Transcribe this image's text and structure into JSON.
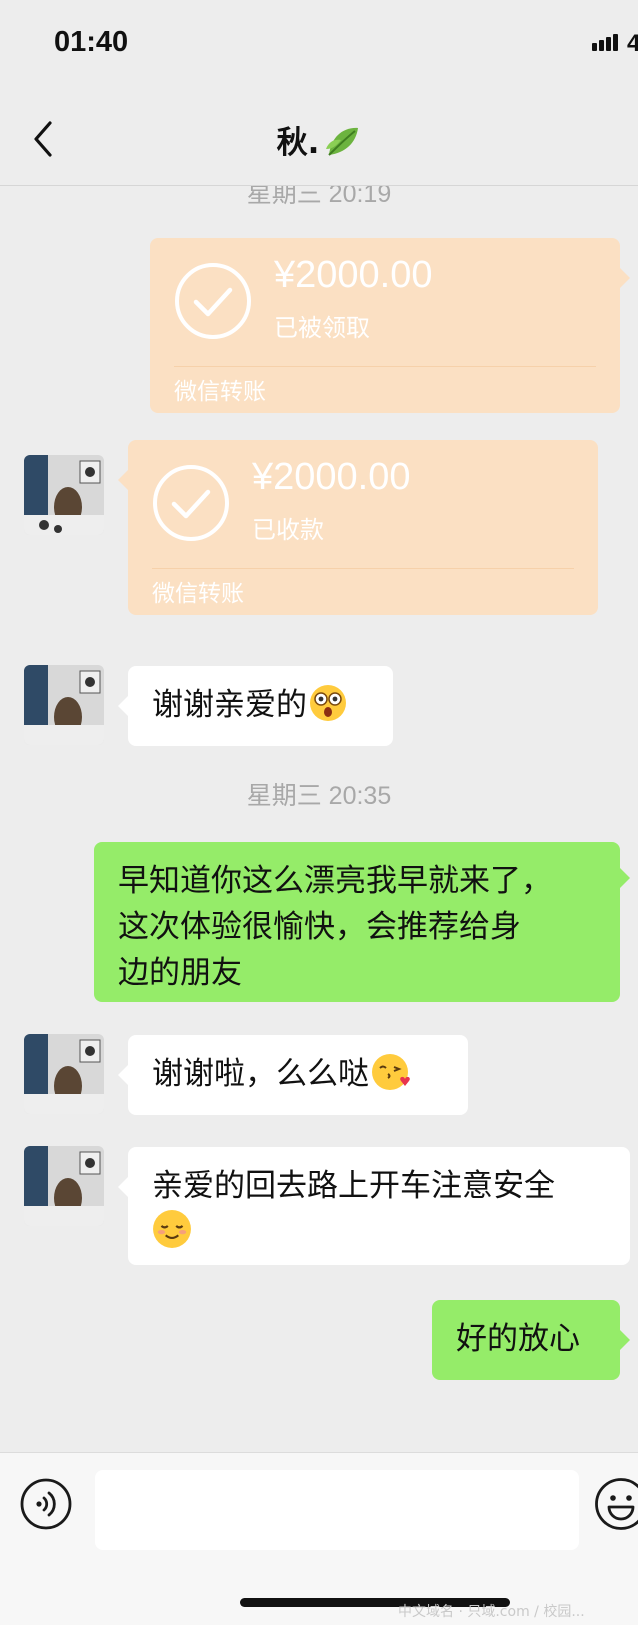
{
  "status_bar": {
    "time": "01:40",
    "battery_fragment": "4"
  },
  "nav": {
    "title": "秋.",
    "title_icon": "leaf-icon"
  },
  "messages": {
    "time1": "星期三 20:19",
    "transfer_out": {
      "amount": "¥2000.00",
      "status": "已被领取",
      "label": "微信转账"
    },
    "transfer_in": {
      "amount": "¥2000.00",
      "status": "已收款",
      "label": "微信转账"
    },
    "msg1": "谢谢亲爱的",
    "time2": "星期三 20:35",
    "msg2_line1": "早知道你这么漂亮我早就来了，",
    "msg2_line2": "这次体验很愉快，会推荐给身",
    "msg2_line3": "边的朋友",
    "msg3": "谢谢啦，么么哒",
    "msg4_line1": "亲爱的回去路上开车注意安全",
    "msg5": "好的放心"
  },
  "input_bar": {
    "value": ""
  },
  "watermark": "中文域名 · 只域.com / 校园..."
}
